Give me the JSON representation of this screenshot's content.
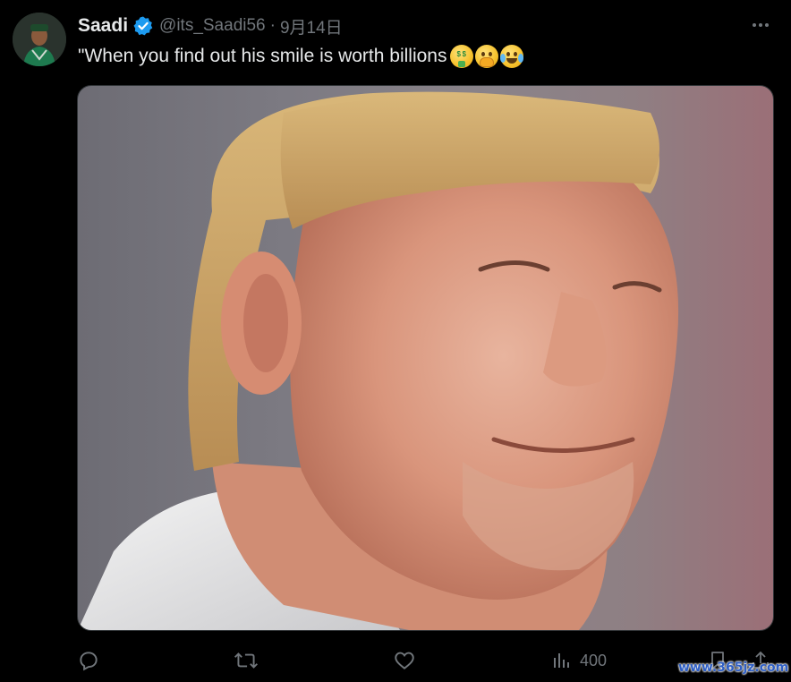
{
  "author": {
    "display_name": "Saadi",
    "handle": "@its_Saadi56",
    "separator": "·",
    "date": "9月14日",
    "verified": true,
    "avatar_icon": "profile-photo-icon"
  },
  "tweet": {
    "text": "\"When you find out his smile is worth billions",
    "emojis": [
      "money-mouth-face",
      "face-with-hand-over-mouth",
      "face-with-tears-of-joy"
    ],
    "media": {
      "description_icon": "photo-icon"
    }
  },
  "actions": {
    "reply_icon": "reply-icon",
    "retweet_icon": "retweet-icon",
    "like_icon": "heart-icon",
    "views_icon": "views-icon",
    "views_count": "400",
    "bookmark_icon": "bookmark-icon",
    "share_icon": "share-icon"
  },
  "watermark": "www.365jz.com",
  "colors": {
    "background": "#000000",
    "text_primary": "#e7e9ea",
    "text_secondary": "#71767b",
    "verified_badge": "#1d9bf0",
    "watermark": "#2f5fc4"
  }
}
